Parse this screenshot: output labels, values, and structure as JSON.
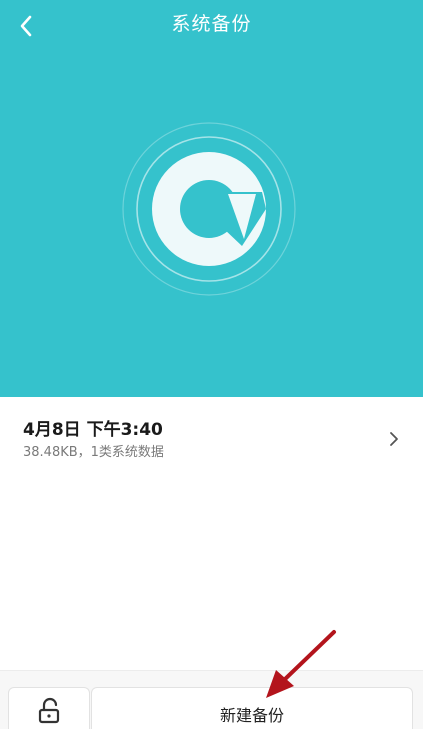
{
  "header": {
    "title": "系统备份",
    "back_icon": "back-chevron-icon"
  },
  "hero": {
    "background_color": "#35c2cc",
    "logo_icon": "backup-restore-icon"
  },
  "backup_record": {
    "title": "4月8日 下午3:40",
    "subtitle": "38.48KB，1类系统数据",
    "chevron_icon": "chevron-right-icon"
  },
  "bottom_bar": {
    "lock_icon": "unlock-icon",
    "new_backup_label": "新建备份"
  },
  "annotation": {
    "arrow_icon": "red-arrow-icon",
    "color": "#b3141c"
  }
}
